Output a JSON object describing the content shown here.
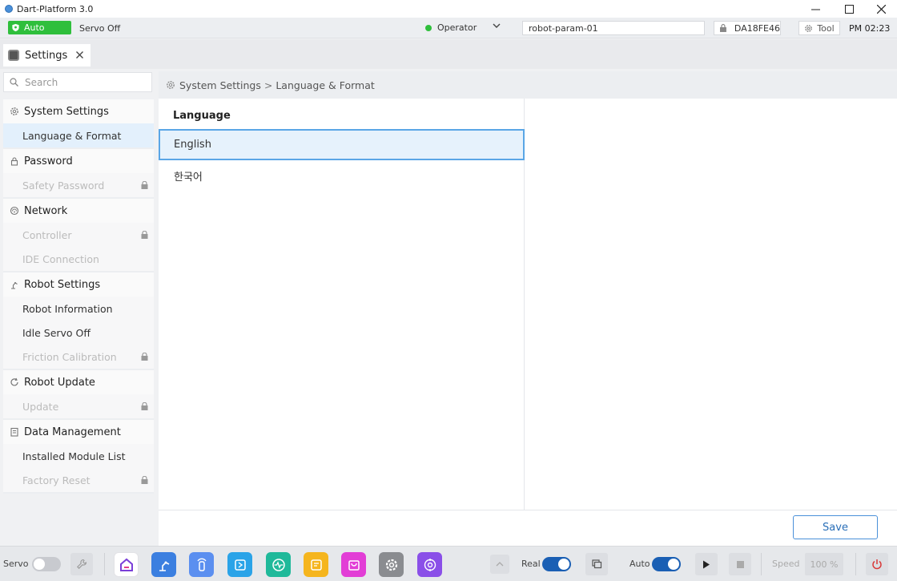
{
  "window": {
    "title": "Dart-Platform 3.0"
  },
  "status": {
    "mode": "Auto",
    "servo": "Servo Off",
    "role": "Operator",
    "robot_param": "robot-param-01",
    "device_id": "DA18FE46",
    "tool": "Tool",
    "time": "PM 02:23",
    "colors": {
      "auto": "#2fbf3c",
      "operator_dot": "#2fbf3c"
    }
  },
  "tabs": [
    {
      "label": "Settings"
    }
  ],
  "sidebar": {
    "search_placeholder": "Search",
    "groups": [
      {
        "label": "System Settings",
        "icon": "gear-icon",
        "items": [
          {
            "label": "Language & Format",
            "selected": true
          }
        ]
      },
      {
        "label": "Password",
        "icon": "lock-icon",
        "items": [
          {
            "label": "Safety Password",
            "locked": true
          }
        ]
      },
      {
        "label": "Network",
        "icon": "network-icon",
        "items": [
          {
            "label": "Controller",
            "locked": true
          },
          {
            "label": "IDE Connection"
          }
        ]
      },
      {
        "label": "Robot Settings",
        "icon": "robot-arm-icon",
        "items": [
          {
            "label": "Robot Information"
          },
          {
            "label": "Idle Servo Off"
          },
          {
            "label": "Friction Calibration",
            "locked": true
          }
        ]
      },
      {
        "label": "Robot Update",
        "icon": "refresh-icon",
        "items": [
          {
            "label": "Update",
            "locked": true
          }
        ]
      },
      {
        "label": "Data Management",
        "icon": "document-icon",
        "items": [
          {
            "label": "Installed Module List"
          },
          {
            "label": "Factory Reset",
            "locked": true
          }
        ]
      }
    ]
  },
  "breadcrumb": {
    "root": "System Settings",
    "separator": ">",
    "current": "Language & Format"
  },
  "language": {
    "section_title": "Language",
    "options": [
      {
        "label": "English",
        "selected": true
      },
      {
        "label": "한국어"
      }
    ]
  },
  "actions": {
    "save": "Save"
  },
  "bottombar": {
    "servo_label": "Servo",
    "real_label": "Real",
    "auto_label": "Auto",
    "speed_label": "Speed",
    "speed_value": "100 %",
    "apps": [
      {
        "icon": "home-icon",
        "color": "#ffffff"
      },
      {
        "icon": "robot-arm-icon",
        "color": "#3b7fe0"
      },
      {
        "icon": "pendant-icon",
        "color": "#5b8ff0"
      },
      {
        "icon": "program-icon",
        "color": "#2aa3e8"
      },
      {
        "icon": "monitor-icon",
        "color": "#1fb99a"
      },
      {
        "icon": "note-icon",
        "color": "#f5b51e"
      },
      {
        "icon": "store-icon",
        "color": "#e23ed6"
      },
      {
        "icon": "settings-icon",
        "color": "#8a8c90"
      },
      {
        "icon": "target-icon",
        "color": "#8a4fe8"
      }
    ]
  }
}
